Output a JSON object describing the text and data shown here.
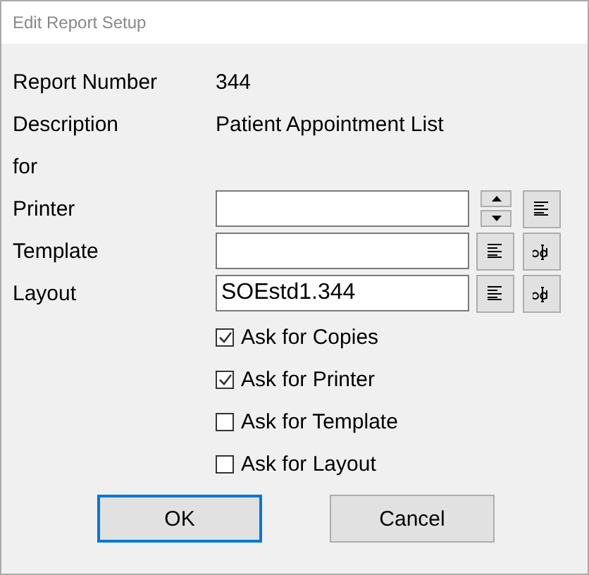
{
  "window": {
    "title": "Edit Report Setup"
  },
  "rows": [
    {
      "kind": "info",
      "label": "Report Number",
      "value": "344"
    },
    {
      "kind": "info",
      "label": "Description",
      "value": "Patient Appointment List"
    },
    {
      "kind": "info",
      "label": "for"
    },
    {
      "kind": "field",
      "label": "Printer",
      "value": "",
      "tools": [
        {
          "kind": "spin"
        },
        {
          "kind": "list"
        }
      ]
    },
    {
      "kind": "field",
      "label": "Template",
      "value": "",
      "tools": [
        {
          "kind": "list"
        },
        {
          "kind": "edit"
        }
      ]
    },
    {
      "kind": "field",
      "label": "Layout",
      "value": "SOEstd1.344",
      "tools": [
        {
          "kind": "list"
        },
        {
          "kind": "edit"
        }
      ]
    }
  ],
  "options": [
    {
      "label": "Ask for Copies",
      "checked": true
    },
    {
      "label": "Ask for Printer",
      "checked": true
    },
    {
      "label": "Ask for Template",
      "checked": false
    },
    {
      "label": "Ask for Layout",
      "checked": false
    }
  ],
  "buttons": [
    {
      "label": "OK",
      "default": true
    },
    {
      "label": "Cancel",
      "default": false
    }
  ]
}
